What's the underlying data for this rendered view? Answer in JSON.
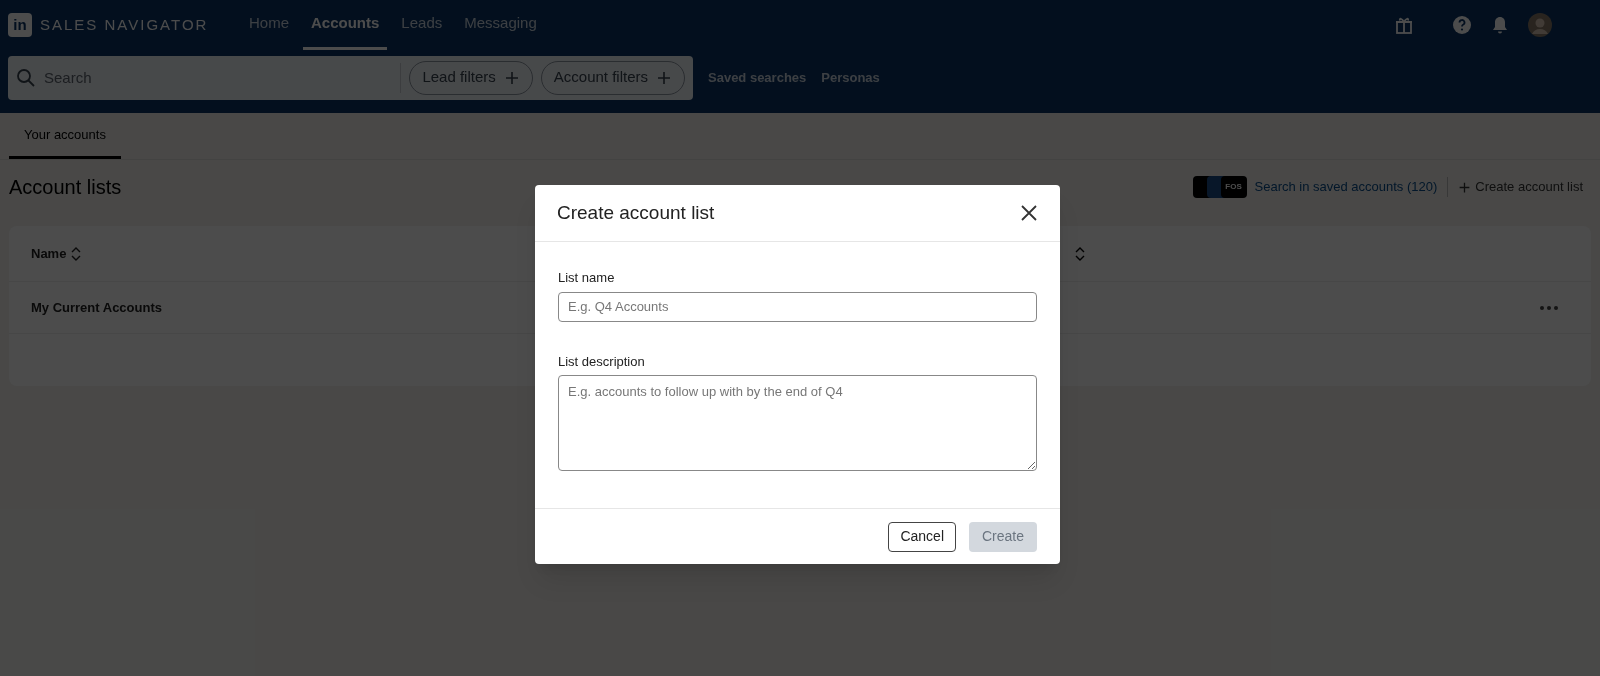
{
  "brand": {
    "logo": "in",
    "name": "SALES NAVIGATOR"
  },
  "nav": [
    {
      "label": "Home",
      "selected": false
    },
    {
      "label": "Accounts",
      "selected": true
    },
    {
      "label": "Leads",
      "selected": false
    },
    {
      "label": "Messaging",
      "selected": false
    }
  ],
  "search": {
    "placeholder": "Search"
  },
  "filters": [
    "Lead filters",
    "Account filters"
  ],
  "links": [
    "Saved searches",
    "Personas"
  ],
  "page_tabs": [
    {
      "label": "Your accounts",
      "selected": true
    }
  ],
  "title": "Account lists",
  "saved_accounts": {
    "logo_text": "FOS",
    "label": "Search in saved accounts (120)"
  },
  "create_link": "Create account list",
  "table": {
    "columns": [
      "Name"
    ],
    "rows": [
      {
        "name": "My Current Accounts"
      }
    ]
  },
  "modal": {
    "title": "Create account list",
    "fields": [
      {
        "kind": "input",
        "label": "List name",
        "placeholder": "E.g. Q4 Accounts"
      },
      {
        "kind": "textarea",
        "label": "List description",
        "placeholder": "E.g. accounts to follow up with by the end of Q4"
      }
    ],
    "buttons": [
      {
        "label": "Cancel",
        "disabled": false
      },
      {
        "label": "Create",
        "disabled": true
      }
    ]
  }
}
